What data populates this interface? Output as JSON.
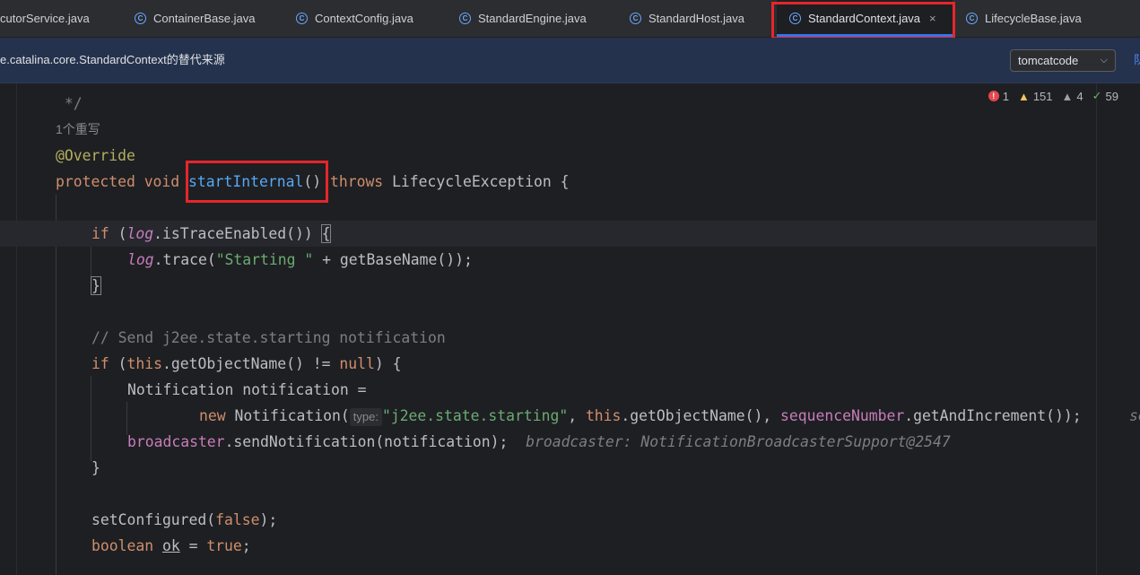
{
  "tabs": [
    {
      "label": "cutorService.java",
      "active": false
    },
    {
      "label": "ContainerBase.java",
      "active": false
    },
    {
      "label": "ContextConfig.java",
      "active": false
    },
    {
      "label": "StandardEngine.java",
      "active": false
    },
    {
      "label": "StandardHost.java",
      "active": false
    },
    {
      "label": "StandardContext.java",
      "active": true,
      "close": "×"
    },
    {
      "label": "LifecycleBase.java",
      "active": false
    }
  ],
  "info_bar": {
    "message": "e.catalina.core.StandardContext的替代来源",
    "source_select": "tomcatcode",
    "link": "队"
  },
  "inspections": {
    "errors": "1",
    "warnings": "151",
    "weak_warnings": "4",
    "ok": "59"
  },
  "code": {
    "comment_end": " */",
    "usages": "1个重写",
    "annotation": "@Override",
    "kw_protected": "protected",
    "kw_void": "void",
    "method_name": "startInternal",
    "parens": "()",
    "kw_throws": "throws",
    "exception": "LifecycleException",
    "open_brace": "{",
    "kw_if": "if",
    "log": "log",
    "is_trace": ".isTraceEnabled()) ",
    "open_paren": "(",
    "trace_call": ".trace(",
    "starting_str": "\"Starting \"",
    "plus_basename": " + getBaseName());",
    "close_brace": "}",
    "send_comment": "// Send j2ee.state.starting notification",
    "kw_this": "this",
    "get_object_name_cond": ".getObjectName() != ",
    "kw_null": "null",
    "cond_close": ") {",
    "notification_decl": "Notification notification =",
    "kw_new": "new",
    "notification_ctor": " Notification(",
    "param_hint": "type:",
    "state_str": "\"j2ee.state.starting\"",
    "comma_space": ", ",
    "get_object_name_arg": ".getObjectName(), ",
    "sequence_number": "sequenceNumber",
    "get_and_increment": ".getAndIncrement());",
    "cut_text": "se",
    "broadcaster": "broadcaster",
    "send_notification": ".sendNotification(notification);",
    "debug_hint": "broadcaster: NotificationBroadcasterSupport@2547",
    "set_configured": "setConfigured(",
    "kw_false": "false",
    "stmt_end": ");",
    "kw_boolean": "boolean",
    "ok_var": "ok",
    "assign": " = ",
    "kw_true": "true",
    "semicolon": ";"
  },
  "colors": {
    "highlight_box": "#e5262b",
    "keyword": "#cf8e6d",
    "string": "#6aab73",
    "method": "#56a8f5",
    "annotation": "#b3ae60"
  }
}
